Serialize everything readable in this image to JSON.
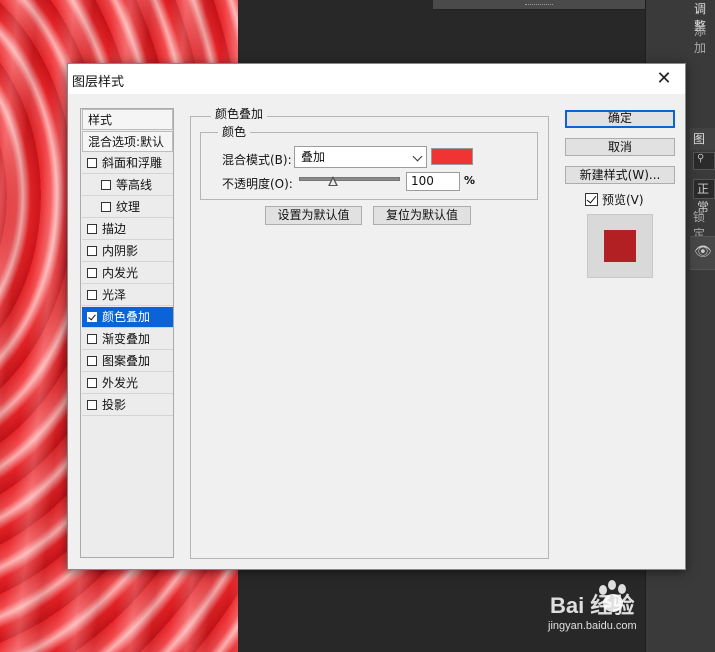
{
  "background_panel": {
    "adjust_title": "调整",
    "add_text": "添加",
    "layers_tab": "图层",
    "search_icon": "search-icon",
    "blend_value": "正常",
    "lock_label": "锁定"
  },
  "dialog": {
    "title": "图层样式",
    "close_glyph": "✕",
    "styles_list": {
      "header": "样式",
      "blending_options": "混合选项:默认",
      "items": [
        {
          "label": "斜面和浮雕",
          "checked": false,
          "indent": false
        },
        {
          "label": "等高线",
          "checked": false,
          "indent": true
        },
        {
          "label": "纹理",
          "checked": false,
          "indent": true
        },
        {
          "label": "描边",
          "checked": false,
          "indent": false
        },
        {
          "label": "内阴影",
          "checked": false,
          "indent": false
        },
        {
          "label": "内发光",
          "checked": false,
          "indent": false
        },
        {
          "label": "光泽",
          "checked": false,
          "indent": false
        },
        {
          "label": "颜色叠加",
          "checked": true,
          "indent": false,
          "selected": true
        },
        {
          "label": "渐变叠加",
          "checked": false,
          "indent": false
        },
        {
          "label": "图案叠加",
          "checked": false,
          "indent": false
        },
        {
          "label": "外发光",
          "checked": false,
          "indent": false
        },
        {
          "label": "投影",
          "checked": false,
          "indent": false
        }
      ]
    },
    "section_title": "颜色叠加",
    "color_group_title": "颜色",
    "blend_mode_label": "混合模式(B):",
    "blend_mode_value": "叠加",
    "overlay_color": "#f03434",
    "opacity_label": "不透明度(O):",
    "opacity_value": "100",
    "opacity_unit": "%",
    "opacity_fraction": 1.0,
    "set_default_label": "设置为默认值",
    "reset_default_label": "复位为默认值",
    "ok_label": "确定",
    "cancel_label": "取消",
    "new_style_label": "新建样式(W)...",
    "preview_label": "预览(V)",
    "preview_checked": true,
    "preview_color": "#b32024"
  },
  "watermark": {
    "brand": "Bai 经验",
    "url": "jingyan.baidu.com"
  }
}
